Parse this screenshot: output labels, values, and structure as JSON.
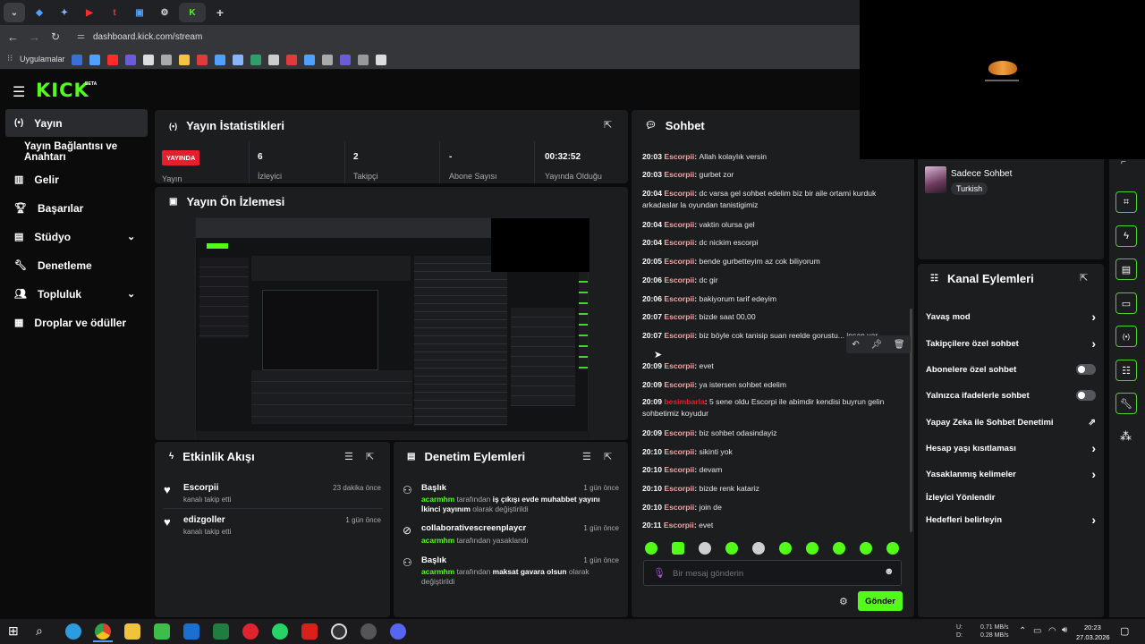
{
  "browser": {
    "url": "dashboard.kick.com/stream",
    "bookmarks_label": "Uygulamalar"
  },
  "brand": {
    "logo": "KICK",
    "beta": "BETA",
    "accent": "#53fc18"
  },
  "sidebar": {
    "items": [
      {
        "label": "Yayın",
        "icon": "broadcast-icon",
        "active": true
      },
      {
        "label": "Yayın Bağlantısı ve Anahtarı",
        "icon": "",
        "active": false
      },
      {
        "label": "Gelir",
        "icon": "chart-icon",
        "active": false
      },
      {
        "label": "Başarılar",
        "icon": "trophy-icon",
        "active": false
      },
      {
        "label": "Stüdyo",
        "icon": "studio-icon",
        "active": false
      },
      {
        "label": "Denetleme",
        "icon": "wrench-icon",
        "active": false
      },
      {
        "label": "Topluluk",
        "icon": "people-icon",
        "active": false
      },
      {
        "label": "Droplar ve ödüller",
        "icon": "gift-icon",
        "active": false
      }
    ]
  },
  "stats": {
    "title": "Yayın İstatistikleri",
    "live_badge": "YAYINDA",
    "live_label": "Yayın",
    "items": [
      {
        "value": "6",
        "label": "İzleyici"
      },
      {
        "value": "2",
        "label": "Takipçi"
      },
      {
        "value": "-",
        "label": "Abone Sayısı"
      },
      {
        "value": "00:32:52",
        "label": "Yayında Olduğu"
      }
    ]
  },
  "preview": {
    "title": "Yayın Ön İzlemesi"
  },
  "activity": {
    "title": "Etkinlik Akışı",
    "items": [
      {
        "user": "Escorpii",
        "text": "kanalı takip etti",
        "time": "23 dakika önce"
      },
      {
        "user": "edizgoller",
        "text": "kanalı takip etti",
        "time": "1 gün önce"
      }
    ]
  },
  "moderation": {
    "title": "Denetim Eylemleri",
    "items": [
      {
        "title": "Başlık",
        "time": "1 gün önce",
        "actor": "acarmhm",
        "pre": "tarafından",
        "bold": "iş çıkışı evde muhabbet yayını İkinci yayınım",
        "post": "olarak değiştirildi"
      },
      {
        "title": "collaborativescreenplaycr",
        "time": "1 gün önce",
        "actor": "acarmhm",
        "pre": "tarafından yasaklandı",
        "bold": "",
        "post": ""
      },
      {
        "title": "Başlık",
        "time": "1 gün önce",
        "actor": "acarmhm",
        "pre": "tarafından",
        "bold": "maksat gavara olsun",
        "post": "olarak değiştirildi"
      }
    ]
  },
  "chat": {
    "title": "Sohbet",
    "messages": [
      {
        "time": "20:03",
        "user": "Escorpii",
        "text": "Allah kolaylık versin"
      },
      {
        "time": "20:03",
        "user": "Escorpii",
        "text": "gurbet zor"
      },
      {
        "time": "20:04",
        "user": "Escorpii",
        "text": "dc varsa gel sohbet edelim biz bir aile ortami kurduk arkadaslar la oyundan tanistigimiz"
      },
      {
        "time": "20:04",
        "user": "Escorpii",
        "text": "vaktin olursa gel"
      },
      {
        "time": "20:04",
        "user": "Escorpii",
        "text": "dc nickim escorpi"
      },
      {
        "time": "20:05",
        "user": "Escorpii",
        "text": "bende gurbetteyim az cok biliyorum"
      },
      {
        "time": "20:06",
        "user": "Escorpii",
        "text": "dc gir"
      },
      {
        "time": "20:06",
        "user": "Escorpii",
        "text": "bakiyorum tarif edeyim"
      },
      {
        "time": "20:07",
        "user": "Escorpii",
        "text": "bizde saat 00,00"
      },
      {
        "time": "20:07",
        "user": "Escorpii",
        "text": "biz böyle cok tanisip suan reelde gorustu... insan var"
      },
      {
        "time": "20:09",
        "user": "Escorpii",
        "text": "evet"
      },
      {
        "time": "20:09",
        "user": "Escorpii",
        "text": "ya istersen sohbet edelim"
      },
      {
        "time": "20:09",
        "user": "besimbarla",
        "text": "5 sene oldu Escorpi ile abimdir kendisi buyrun gelin sohbetimiz koyudur"
      },
      {
        "time": "20:09",
        "user": "Escorpii",
        "text": "biz sohbet odasindayiz"
      },
      {
        "time": "20:10",
        "user": "Escorpii",
        "text": "sikinti yok"
      },
      {
        "time": "20:10",
        "user": "Escorpii",
        "text": "devam"
      },
      {
        "time": "20:10",
        "user": "Escorpii",
        "text": "bizde renk katariz"
      },
      {
        "time": "20:10",
        "user": "Escorpii",
        "text": "join de"
      },
      {
        "time": "20:11",
        "user": "Escorpii",
        "text": "evet"
      }
    ],
    "input_placeholder": "Bir mesaj gönderin",
    "send_label": "Gönder"
  },
  "chat_mode": {
    "label": "Sadece Sohbet",
    "language": "Turkish"
  },
  "channel_actions": {
    "title": "Kanal Eylemleri",
    "items": [
      {
        "label": "Yavaş mod",
        "kind": "arrow"
      },
      {
        "label": "Takipçilere özel sohbet",
        "kind": "arrow"
      },
      {
        "label": "Abonelere özel sohbet",
        "kind": "toggle"
      },
      {
        "label": "Yalnızca ifadelerle sohbet",
        "kind": "toggle"
      },
      {
        "label": "Yapay Zeka ile Sohbet Denetimi",
        "kind": "external"
      },
      {
        "label": "Hesap yaşı kısıtlaması",
        "kind": "arrow"
      },
      {
        "label": "Yasaklanmış kelimeler",
        "kind": "arrow"
      },
      {
        "label": "İzleyici Yönlendir",
        "kind": "none"
      },
      {
        "label": "Hedefleri belirleyin",
        "kind": "arrow"
      }
    ]
  },
  "taskbar": {
    "net_up": "0.71 MB/s",
    "net_down": "0.28 MB/s",
    "up_label": "U:",
    "down_label": "D:",
    "time": "20:23",
    "date": "27.03.2026"
  }
}
